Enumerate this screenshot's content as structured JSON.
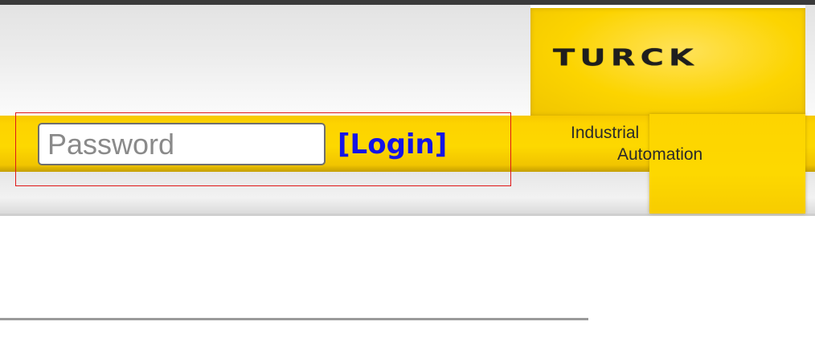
{
  "header": {
    "logo": {
      "brand": "TURCK",
      "tagline_line1": "Industrial",
      "tagline_line2": "Automation"
    }
  },
  "login": {
    "password_placeholder": "Password",
    "password_value": "",
    "login_label": "[Login]"
  },
  "colors": {
    "brand_yellow": "#fdd400",
    "login_link": "#1414e6",
    "highlight_border": "#e01818"
  },
  "icons": [
    "turck-logo"
  ]
}
